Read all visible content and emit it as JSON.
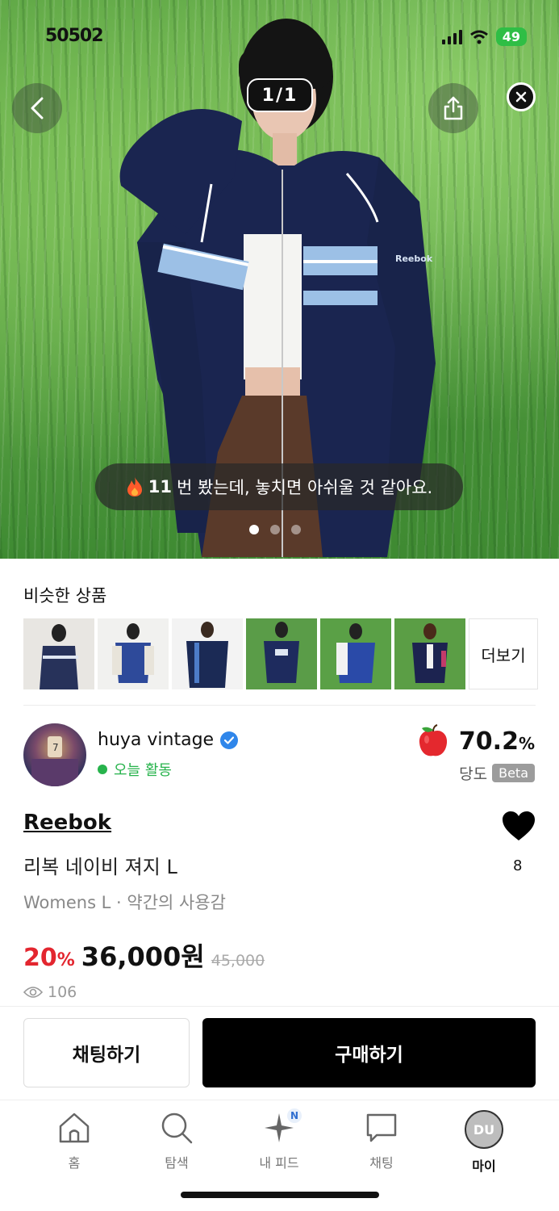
{
  "status_bar": {
    "time": "50502",
    "battery": "49"
  },
  "hero": {
    "image_counter": "1/1",
    "views_count": "11",
    "views_message": "번 봤는데, 놓치면 아쉬울 것 같아요.",
    "brand_on_jacket": "Reebok"
  },
  "similar": {
    "title": "비슷한 상품",
    "more_label": "더보기"
  },
  "seller": {
    "name": "huya vintage",
    "activity": "오늘 활동",
    "score": "70.2",
    "score_unit": "%",
    "score_label": "당도",
    "beta": "Beta"
  },
  "product": {
    "brand": "Reebok",
    "name": "리복 네이비 져지 L",
    "meta": "Womens L · 약간의 사용감",
    "discount": "20",
    "discount_unit": "%",
    "price": "36,000원",
    "original_price": "45,000",
    "likes": "8",
    "views": "106"
  },
  "actions": {
    "chat_label": "채팅하기",
    "buy_label": "구매하기"
  },
  "tabs": [
    {
      "label": "홈",
      "icon": "home-icon"
    },
    {
      "label": "탐색",
      "icon": "search-icon"
    },
    {
      "label": "내 피드",
      "icon": "sparkle-icon",
      "badge": "N"
    },
    {
      "label": "채팅",
      "icon": "chat-bubble-icon"
    },
    {
      "label": "마이",
      "icon": "avatar",
      "avatar_text": "DU"
    }
  ],
  "colors": {
    "accent_red": "#e3262f",
    "active_green": "#27b34c",
    "verified_blue": "#2f86ea",
    "buy_black": "#000000"
  }
}
